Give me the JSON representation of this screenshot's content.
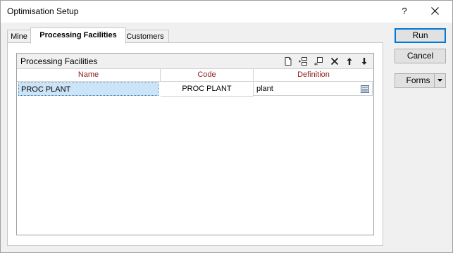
{
  "window": {
    "title": "Optimisation Setup",
    "help_glyph": "?"
  },
  "tabs": [
    {
      "label": "Mine"
    },
    {
      "label": "Processing Facilities",
      "active": true
    },
    {
      "label": "Customers"
    }
  ],
  "grid": {
    "title": "Processing Facilities",
    "toolbar_icons": [
      "new-row-icon",
      "insert-row-icon",
      "append-row-icon",
      "delete-row-icon",
      "move-up-icon",
      "move-down-icon"
    ],
    "columns": [
      "Name",
      "Code",
      "Definition"
    ],
    "rows": [
      {
        "name": "PROC PLANT",
        "code": "PROC PLANT",
        "definition": "plant"
      }
    ]
  },
  "buttons": {
    "run": "Run",
    "cancel": "Cancel",
    "forms": "Forms"
  },
  "colors": {
    "column_header_text": "#8b1a1a",
    "selection": "#cce4f7",
    "default_button_border": "#0078d7"
  }
}
